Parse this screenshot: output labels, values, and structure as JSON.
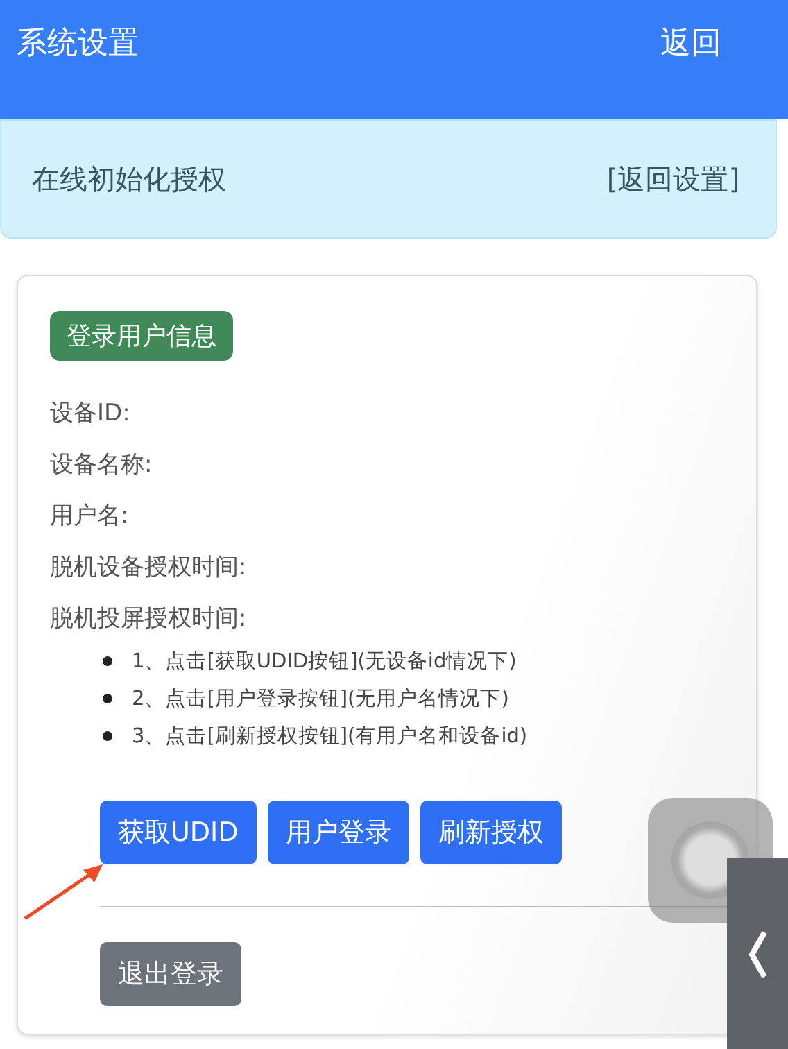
{
  "header": {
    "title": "系统设置",
    "back": "返回"
  },
  "alert": {
    "title": "在线初始化授权",
    "link": "[返回设置]"
  },
  "card": {
    "badge": "登录用户信息",
    "fields": [
      "设备ID:",
      "设备名称:",
      "用户名:",
      "脱机设备授权时间:",
      "脱机投屏授权时间:"
    ],
    "steps": [
      "1、点击[获取UDID按钮](无设备id情况下)",
      "2、点击[用户登录按钮](无用户名情况下)",
      "3、点击[刷新授权按钮](有用户名和设备id)"
    ],
    "actions": [
      {
        "label": "获取UDID",
        "kind": "primary"
      },
      {
        "label": "用户登录",
        "kind": "primary"
      },
      {
        "label": "刷新授权",
        "kind": "primary"
      }
    ],
    "logout": {
      "label": "退出登录",
      "kind": "secondary"
    }
  }
}
